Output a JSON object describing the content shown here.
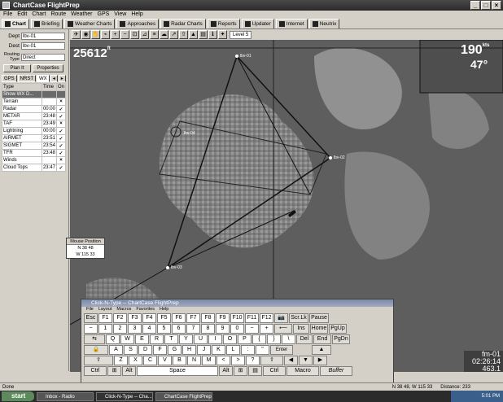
{
  "window": {
    "title": "ChartCase FlightPrep"
  },
  "menu": [
    "File",
    "Edit",
    "Chart",
    "Route",
    "Weather",
    "GPS",
    "View",
    "Help"
  ],
  "tabs": [
    {
      "label": "Chart",
      "icon": "airplane-icon",
      "active": true
    },
    {
      "label": "Briefing",
      "icon": "briefing-icon"
    },
    {
      "label": "Weather Charts",
      "icon": "weather-icon"
    },
    {
      "label": "Approaches",
      "icon": "approach-icon"
    },
    {
      "label": "Radar Charts",
      "icon": "radar-icon"
    },
    {
      "label": "Reports",
      "icon": "reports-icon"
    },
    {
      "label": "Updater",
      "icon": "updater-icon"
    },
    {
      "label": "Internet",
      "icon": "internet-icon"
    },
    {
      "label": "Neutrix",
      "icon": "neutrix-icon"
    }
  ],
  "route": {
    "dept_label": "Dept",
    "dept_value": "lbv-01",
    "dest_label": "Dest",
    "dest_value": "lbv-01",
    "routing_label": "Routing Type",
    "routing_value": "Direct",
    "plan_button": "Plan It",
    "properties_button": "Properties"
  },
  "wx_tabs": [
    "GPS",
    "NRST",
    "WX"
  ],
  "wx_table": {
    "headers": [
      "Type",
      "Time",
      "On"
    ],
    "rows": [
      {
        "type": "Show WX D...",
        "time": "",
        "on": ""
      },
      {
        "type": "Terrain",
        "time": "",
        "on": "×"
      },
      {
        "type": "Radar",
        "time": "00:00",
        "on": "✓"
      },
      {
        "type": "METAR",
        "time": "23:48",
        "on": "✓"
      },
      {
        "type": "TAF",
        "time": "23:49",
        "on": "×"
      },
      {
        "type": "Lightning",
        "time": "00:00",
        "on": "✓"
      },
      {
        "type": "AIRMET",
        "time": "23:51",
        "on": "✓"
      },
      {
        "type": "SIGMET",
        "time": "23:54",
        "on": "✓"
      },
      {
        "type": "TFR",
        "time": "23:48",
        "on": "✓"
      },
      {
        "type": "Winds",
        "time": "",
        "on": "×"
      },
      {
        "type": "Cloud Tops",
        "time": "23:47",
        "on": "✓"
      }
    ]
  },
  "mouse_position": {
    "title": "Mouse Position",
    "lat": "N 38 48",
    "lon": "W 115 33"
  },
  "toolbar": {
    "level": "Level 5"
  },
  "map": {
    "altitude": "25612",
    "altitude_unit": "ft",
    "speed": "190",
    "speed_unit": "kts",
    "heading": "47°",
    "time_label": "fm-01",
    "time_value": "02:26:14",
    "time_sub": "463.1",
    "waypoints": [
      "lbv-01",
      "lbv-02",
      "lbv-03",
      "lbv-04"
    ]
  },
  "keyboard": {
    "title": "Click-N-Type -- ChartCase FlightPrep",
    "menu": [
      "File",
      "Layout",
      "Macros",
      "Favorites",
      "Help"
    ],
    "rows": [
      [
        "Esc",
        "F1",
        "F2",
        "F3",
        "F4",
        "F5",
        "F6",
        "F7",
        "F8",
        "F9",
        "F10",
        "F11",
        "F12",
        "📷",
        "Scr.Lk",
        "Pause"
      ],
      [
        "~",
        "1",
        "2",
        "3",
        "4",
        "5",
        "6",
        "7",
        "8",
        "9",
        "0",
        "−",
        "+",
        "⟵",
        "Ins",
        "Home",
        "PgUp"
      ],
      [
        "⇆",
        "Q",
        "W",
        "E",
        "R",
        "T",
        "Y",
        "U",
        "I",
        "O",
        "P",
        "{",
        "}",
        "\\",
        "Del",
        "End",
        "PgDn"
      ],
      [
        "🔒",
        "A",
        "S",
        "D",
        "F",
        "G",
        "H",
        "J",
        "K",
        "L",
        ":",
        "\"",
        "Enter"
      ],
      [
        "⇧",
        "Z",
        "X",
        "C",
        "V",
        "B",
        "N",
        "M",
        "<",
        ">",
        "?",
        "⇧"
      ],
      [
        "Ctrl",
        "⊞",
        "Alt",
        "Space",
        "Alt",
        "⊞",
        "▤",
        "Ctrl"
      ]
    ],
    "macro": "Macro",
    "buffer": "Buffer"
  },
  "status": {
    "left": "Done",
    "coords": "N 38 48, W 115 33",
    "distance": "Distance: 233"
  },
  "taskbar": {
    "start": "start",
    "tasks": [
      "Inbox - Radio",
      "Click-N-Type -- Cha...",
      "ChartCase FlightPrep"
    ],
    "clock": "5:01 PM"
  }
}
